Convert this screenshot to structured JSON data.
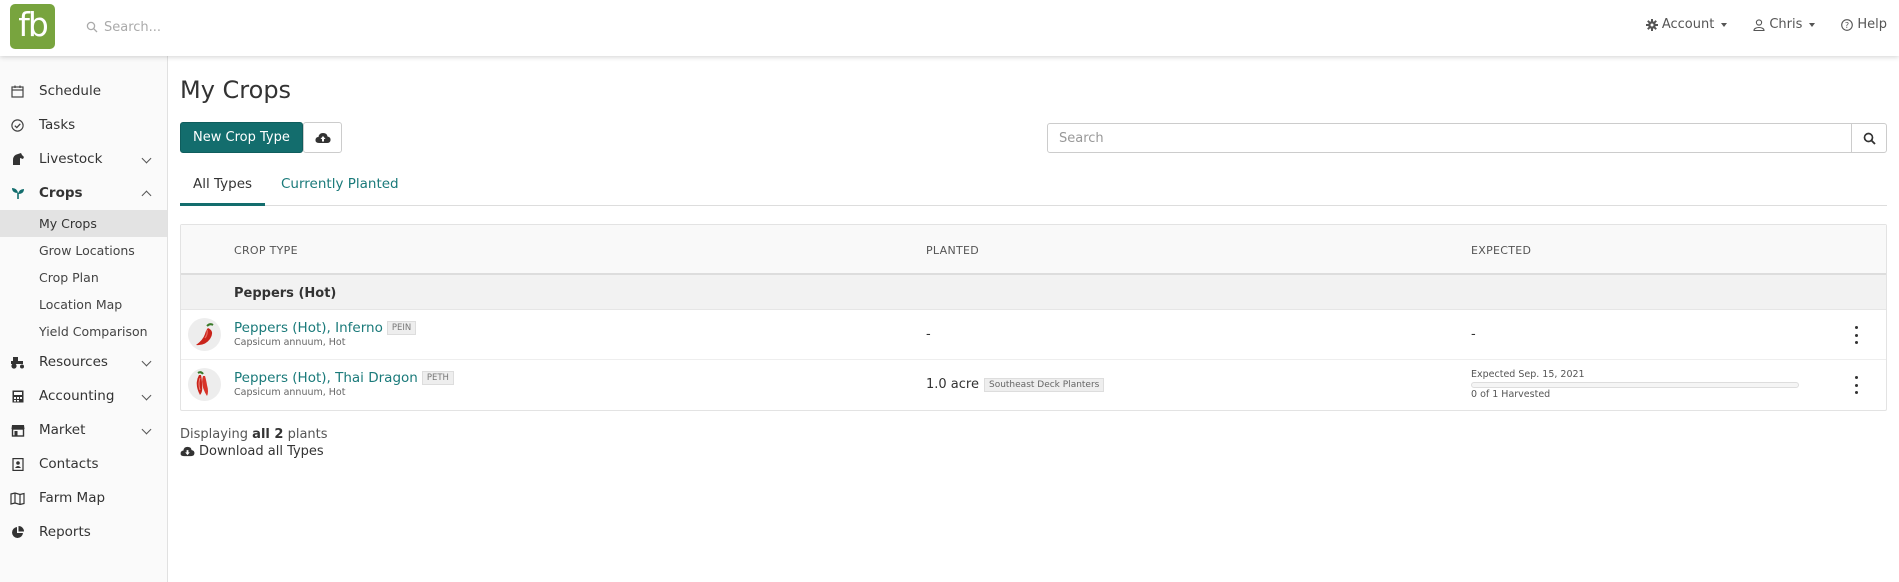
{
  "brand": {
    "logo_text": "fb",
    "color": "#78a43e"
  },
  "topbar": {
    "search_placeholder": "Search...",
    "account_label": "Account",
    "user_label": "Chris",
    "help_label": "Help"
  },
  "sidebar": {
    "items": [
      {
        "label": "Schedule",
        "icon": "calendar-icon"
      },
      {
        "label": "Tasks",
        "icon": "check-circle-icon"
      },
      {
        "label": "Livestock",
        "icon": "horse-icon"
      },
      {
        "label": "Crops",
        "icon": "seedling-icon"
      },
      {
        "label": "Resources",
        "icon": "tractor-icon"
      },
      {
        "label": "Accounting",
        "icon": "calculator-icon"
      },
      {
        "label": "Market",
        "icon": "store-icon"
      },
      {
        "label": "Contacts",
        "icon": "address-book-icon"
      },
      {
        "label": "Farm Map",
        "icon": "map-icon"
      },
      {
        "label": "Reports",
        "icon": "pie-chart-icon"
      }
    ],
    "crops_sub": [
      "My Crops",
      "Grow Locations",
      "Crop Plan",
      "Location Map",
      "Yield Comparison"
    ]
  },
  "page": {
    "title": "My Crops",
    "new_button": "New Crop Type",
    "search_placeholder": "Search",
    "tabs": [
      "All Types",
      "Currently Planted"
    ]
  },
  "table": {
    "headers": [
      "CROP TYPE",
      "PLANTED",
      "EXPECTED"
    ],
    "group": "Peppers (Hot)",
    "rows": [
      {
        "name": "Peppers (Hot), Inferno",
        "code": "PEIN",
        "scientific": "Capsicum annuum, Hot",
        "planted": "-",
        "expected": "-"
      },
      {
        "name": "Peppers (Hot), Thai Dragon",
        "code": "PETH",
        "scientific": "Capsicum annuum, Hot",
        "planted": "1.0 acre",
        "location": "Southeast Deck Planters",
        "expected_date": "Expected Sep. 15, 2021",
        "harvested": "0 of 1 Harvested",
        "progress": 0
      }
    ]
  },
  "footer": {
    "displaying_prefix": "Displaying",
    "displaying_bold": "all 2",
    "displaying_suffix": "plants",
    "download_label": "Download all Types"
  },
  "colors": {
    "primary": "#136d6d",
    "link": "#1a7a7a"
  }
}
